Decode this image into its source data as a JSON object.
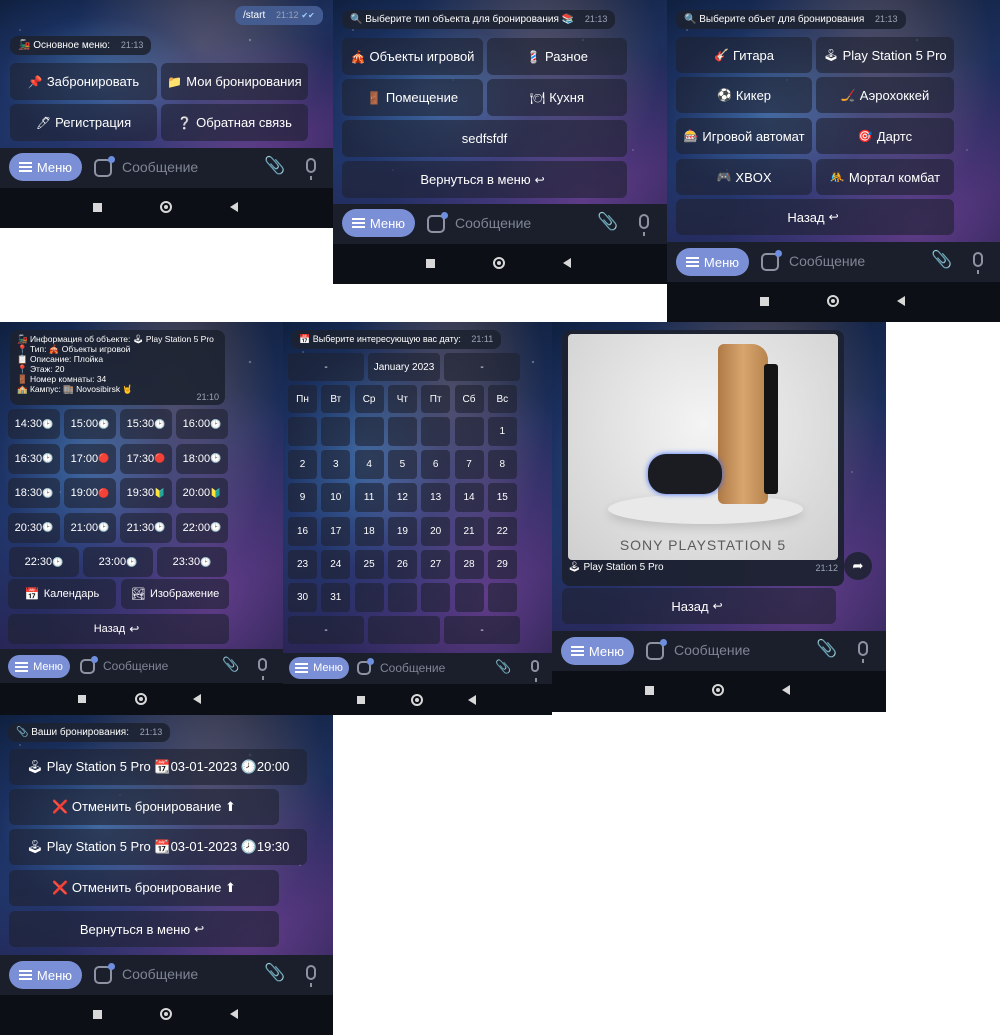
{
  "p1": {
    "outgoing": {
      "text": "/start",
      "time": "21:12",
      "checks": "✔✔"
    },
    "header": {
      "emoji": "🚂",
      "text": "Основное меню:",
      "time": "21:13"
    },
    "buttons": [
      {
        "emoji": "📌",
        "label": "Забронировать"
      },
      {
        "emoji": "📁",
        "label": "Мои бронирования"
      },
      {
        "emoji": "🖊",
        "label": "Регистрация"
      },
      {
        "emoji": "❔",
        "label": "Обратная связь"
      }
    ]
  },
  "p2": {
    "header": {
      "emoji": "🔍",
      "text": "Выберите тип объекта для бронирования",
      "emoji2": "📚",
      "time": "21:13"
    },
    "buttons": [
      {
        "emoji": "🎪",
        "label": "Объекты игровой"
      },
      {
        "emoji": "💈",
        "label": "Разное"
      },
      {
        "emoji": "🚪",
        "label": "Помещение"
      },
      {
        "emoji": "🍽",
        "label": "Кухня"
      },
      {
        "emoji": "",
        "label": "sedfsfdf"
      },
      {
        "emoji": "↩",
        "label": "Вернуться в меню"
      }
    ]
  },
  "p3": {
    "header": {
      "emoji": "🔍",
      "text": "Выберите объет для бронирования",
      "time": "21:13"
    },
    "buttons": [
      {
        "emoji": "🎸",
        "label": "Гитара"
      },
      {
        "emoji": "🕹",
        "label": "Play Station 5 Pro"
      },
      {
        "emoji": "⚽",
        "label": "Кикер"
      },
      {
        "emoji": "🏒",
        "label": "Аэрохоккей"
      },
      {
        "emoji": "🎰",
        "label": "Игровой автомат"
      },
      {
        "emoji": "🎯",
        "label": "Дартс"
      },
      {
        "emoji": "🎮",
        "label": "XBOX"
      },
      {
        "emoji": "🤼",
        "label": "Мортал комбат"
      },
      {
        "emoji": "↩",
        "label": "Назад"
      }
    ]
  },
  "p4": {
    "info": [
      "🚂 Информация об объекте: 🕹 Play Station 5 Pro",
      "📍 Тип: 🎪 Объекты игровой",
      "📋 Описание: Плойка",
      "📍 Этаж: 20",
      "🚪 Номер комнаты: 34",
      "🏫 Кампус: 🏬 Novosibirsk 🤘"
    ],
    "time": "21:10",
    "slots": [
      {
        "t": "14:30",
        "s": "🕑"
      },
      {
        "t": "15:00",
        "s": "🕑"
      },
      {
        "t": "15:30",
        "s": "🕑"
      },
      {
        "t": "16:00",
        "s": "🕑"
      },
      {
        "t": "16:30",
        "s": "🕑"
      },
      {
        "t": "17:00",
        "s": "🔴"
      },
      {
        "t": "17:30",
        "s": "🔴"
      },
      {
        "t": "18:00",
        "s": "🕑"
      },
      {
        "t": "18:30",
        "s": "🕑"
      },
      {
        "t": "19:00",
        "s": "🔴"
      },
      {
        "t": "19:30",
        "s": "🔰"
      },
      {
        "t": "20:00",
        "s": "🔰"
      },
      {
        "t": "20:30",
        "s": "🕑"
      },
      {
        "t": "21:00",
        "s": "🕑"
      },
      {
        "t": "21:30",
        "s": "🕑"
      },
      {
        "t": "22:00",
        "s": "🕑"
      },
      {
        "t": "22:30",
        "s": "🕑"
      },
      {
        "t": "23:00",
        "s": "🕑"
      },
      {
        "t": "23:30",
        "s": "🕑"
      }
    ],
    "calendar_btn": {
      "emoji": "📅",
      "label": "Календарь"
    },
    "image_btn": {
      "emoji": "🏞",
      "label": "Изображение"
    },
    "back_btn": {
      "emoji": "↩",
      "label": "Назад"
    }
  },
  "p5": {
    "header": {
      "emoji": "📅",
      "text": "Выберите интересующую вас дату:",
      "time": "21:11"
    },
    "prev": "-",
    "month": "January 2023",
    "next": "-",
    "weekdays": [
      "Пн",
      "Вт",
      "Ср",
      "Чт",
      "Пт",
      "Сб",
      "Вс"
    ],
    "days": [
      "",
      "",
      "",
      "",
      "",
      "",
      "1",
      "2",
      "3",
      "4",
      "5",
      "6",
      "7",
      "8",
      "9",
      "10",
      "11",
      "12",
      "13",
      "14",
      "15",
      "16",
      "17",
      "18",
      "19",
      "20",
      "21",
      "22",
      "23",
      "24",
      "25",
      "26",
      "27",
      "28",
      "29",
      "30",
      "31",
      "",
      "",
      "",
      "",
      ""
    ],
    "footer": [
      "-",
      "",
      "-"
    ]
  },
  "p6": {
    "image_caption": "SONY PLAYSTATION 5",
    "caption": {
      "emoji": "🕹",
      "text": "Play Station 5 Pro",
      "time": "21:12"
    },
    "back_btn": {
      "emoji": "↩",
      "label": "Назад"
    }
  },
  "p7": {
    "header": {
      "emoji": "📎",
      "text": "Ваши бронирования:",
      "time": "21:13"
    },
    "bookings": [
      {
        "label": "🕹 Play Station 5 Pro 📆03-01-2023 🕗20:00",
        "cancel": "❌ Отменить бронирование ⬆"
      },
      {
        "label": "🕹 Play Station 5 Pro 📆03-01-2023 🕗19:30",
        "cancel": "❌ Отменить бронирование ⬆"
      }
    ],
    "back_btn": {
      "emoji": "↩",
      "label": "Вернуться в меню"
    }
  },
  "common": {
    "menu_label": "Меню",
    "message_placeholder": "Сообщение",
    "accent": "#7a8fd6"
  }
}
